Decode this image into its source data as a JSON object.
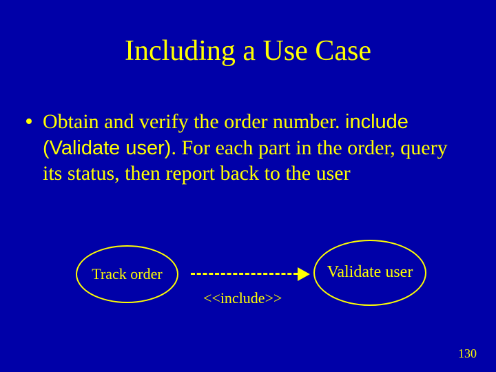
{
  "title": "Including a Use Case",
  "bullet": {
    "line1": "Obtain and verify the order number. ",
    "include_phrase": "include (Validate user)",
    "rest": ". For each part in the order, query its status, then report back to the user"
  },
  "diagram": {
    "left_usecase": "Track order",
    "right_usecase": "Validate user",
    "stereotype": "<<include>>"
  },
  "page_number": "130"
}
